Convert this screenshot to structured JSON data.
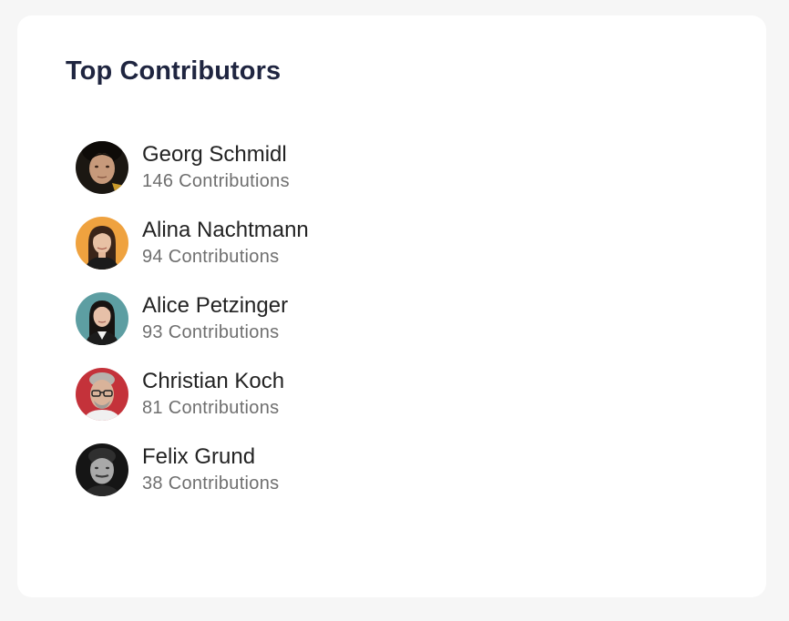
{
  "widget": {
    "title": "Top Contributors"
  },
  "contributors": [
    {
      "name": "Georg Schmidl",
      "contributions": "146 Contributions",
      "avatar_icon": "avatar-georg"
    },
    {
      "name": "Alina Nachtmann",
      "contributions": "94 Contributions",
      "avatar_icon": "avatar-alina"
    },
    {
      "name": "Alice Petzinger",
      "contributions": "93 Contributions",
      "avatar_icon": "avatar-alice"
    },
    {
      "name": "Christian Koch",
      "contributions": "81 Contributions",
      "avatar_icon": "avatar-christian"
    },
    {
      "name": "Felix Grund",
      "contributions": "38 Contributions",
      "avatar_icon": "avatar-felix"
    }
  ],
  "colors": {
    "page_background": "#f6f6f6",
    "card_background": "#ffffff",
    "title": "#1f2540",
    "name": "#232323",
    "count": "#6f6f6f"
  }
}
